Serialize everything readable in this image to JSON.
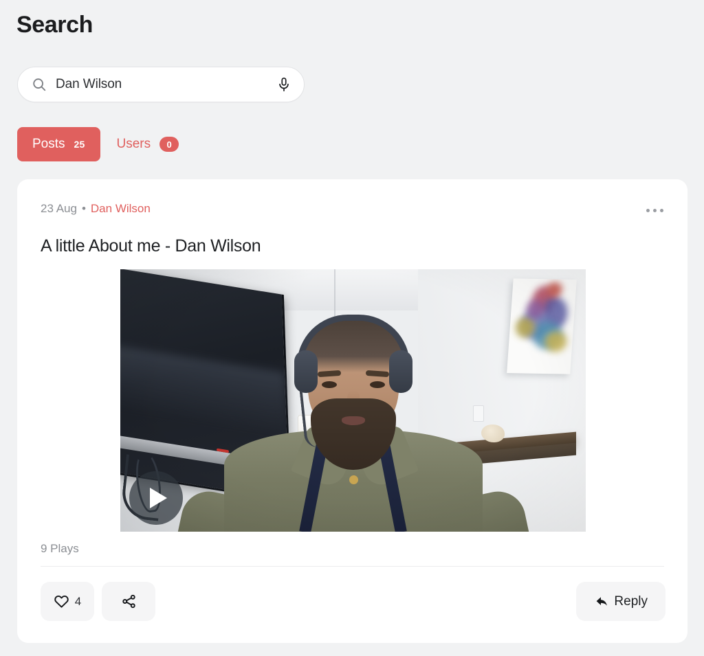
{
  "page": {
    "title": "Search",
    "background_color": "#f1f2f3",
    "accent_color": "#e0605e"
  },
  "search": {
    "value": "Dan Wilson",
    "placeholder": "Search",
    "search_icon": "search-icon",
    "mic_icon": "microphone-icon"
  },
  "tabs": [
    {
      "label": "Posts",
      "count": "25",
      "active": true
    },
    {
      "label": "Users",
      "count": "0",
      "active": false
    }
  ],
  "post": {
    "date": "23 Aug",
    "separator": "•",
    "author": "Dan Wilson",
    "title": "A little About me - Dan Wilson",
    "more_icon": "more-horizontal-icon",
    "plays": "9 Plays",
    "video": {
      "play_icon": "play-icon",
      "alt": "Bearded man wearing a headset seated in a white room with a wall-mounted TV, wooden shelf and abstract artwork"
    },
    "actions": {
      "like": {
        "icon": "heart-icon",
        "count": "4"
      },
      "share": {
        "icon": "share-icon"
      },
      "reply": {
        "icon": "reply-arrow-icon",
        "label": "Reply"
      }
    }
  }
}
